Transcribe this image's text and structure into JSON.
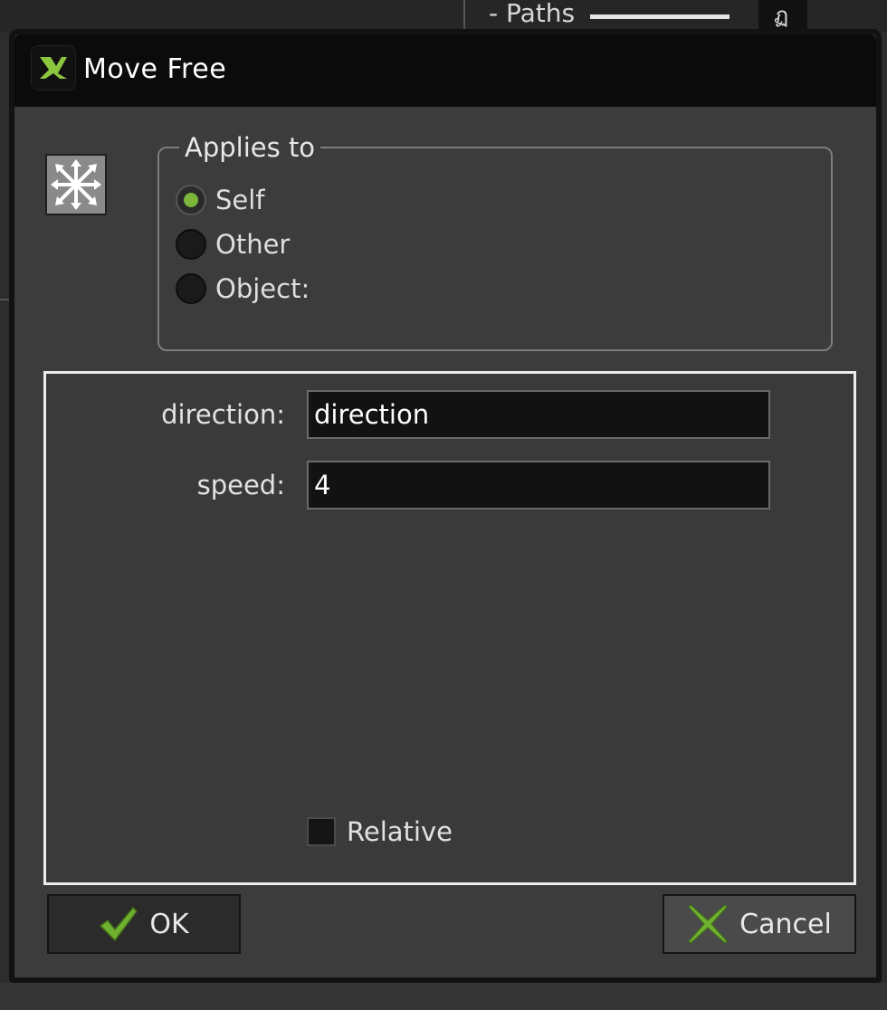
{
  "background": {
    "panel_label": "- Paths",
    "panel_glyph": "ฏ"
  },
  "dialog": {
    "title": "Move Free",
    "app_icon_glyph": "ꭤ",
    "action_icon": "move-arrows-icon",
    "applies_to": {
      "legend": "Applies to",
      "options": [
        {
          "label": "Self",
          "checked": true
        },
        {
          "label": "Other",
          "checked": false
        },
        {
          "label": "Object:",
          "checked": false
        }
      ]
    },
    "arguments": {
      "direction": {
        "label": "direction:",
        "value": "direction"
      },
      "speed": {
        "label": "speed:",
        "value": "4"
      }
    },
    "relative": {
      "label": "Relative",
      "checked": false
    },
    "buttons": {
      "ok_label": "OK",
      "cancel_label": "Cancel"
    },
    "colors": {
      "accent": "#7cb63a",
      "dialog_bg": "#3c3c3c",
      "titlebar_bg": "#0b0b0b"
    }
  }
}
